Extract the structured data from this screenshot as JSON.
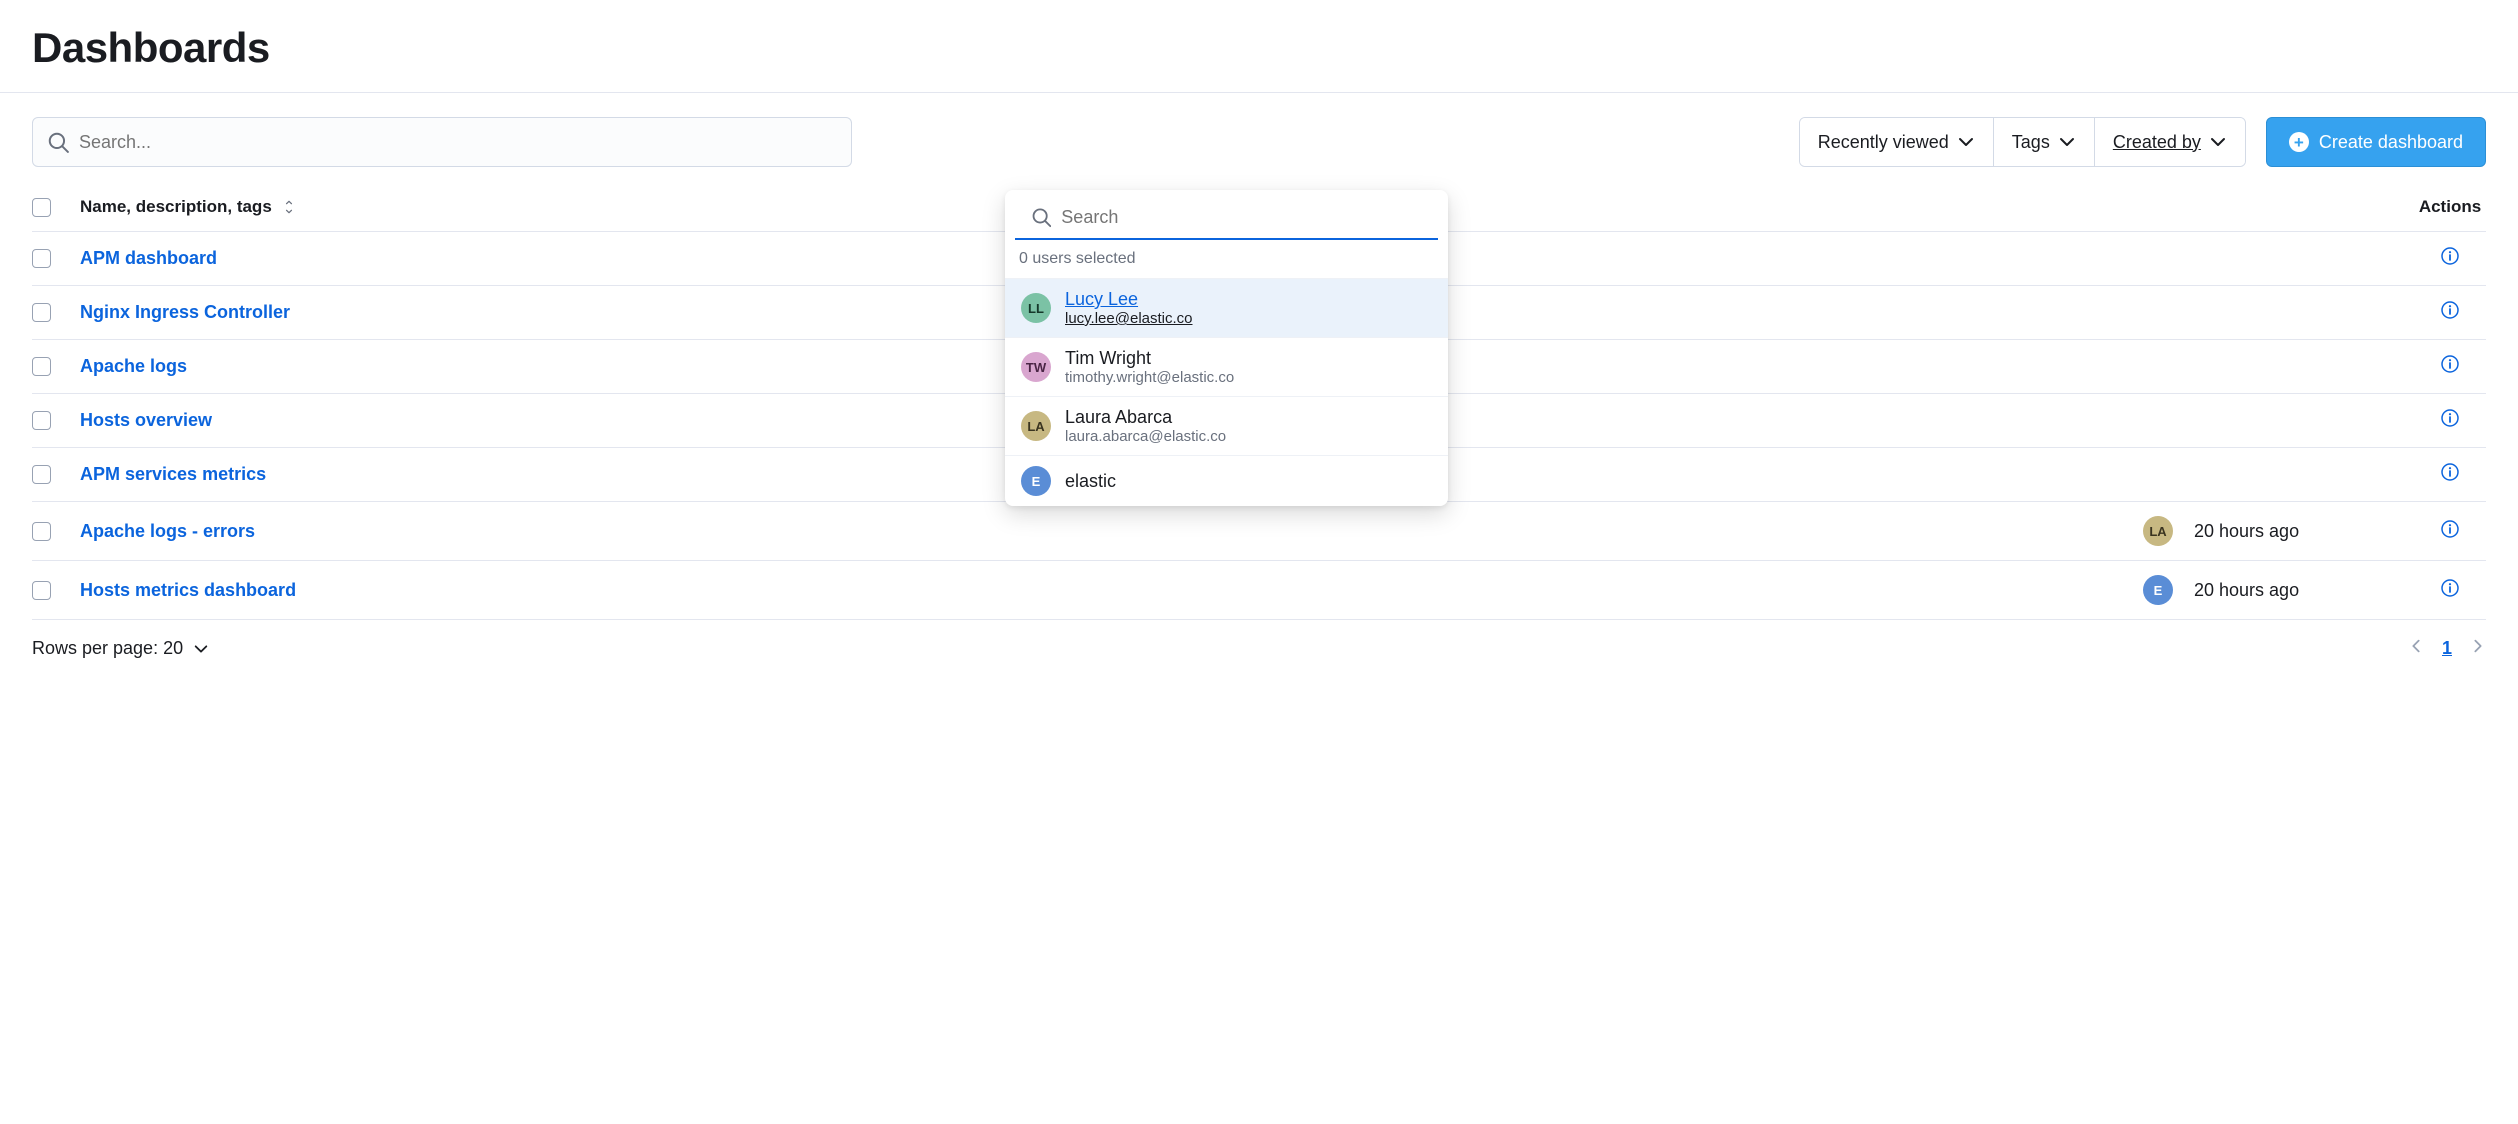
{
  "header": {
    "title": "Dashboards"
  },
  "search": {
    "placeholder": "Search..."
  },
  "filters": {
    "recent": "Recently viewed",
    "tags": "Tags",
    "created_by": "Created by"
  },
  "create_button": "Create dashboard",
  "columns": {
    "name": "Name, description, tags",
    "actions": "Actions"
  },
  "rows": [
    {
      "name": "APM dashboard",
      "creator": null,
      "updated": ""
    },
    {
      "name": "Nginx Ingress Controller",
      "creator": null,
      "updated": ""
    },
    {
      "name": "Apache logs",
      "creator": null,
      "updated": ""
    },
    {
      "name": "Hosts overview",
      "creator": null,
      "updated": ""
    },
    {
      "name": "APM services metrics",
      "creator": null,
      "updated": ""
    },
    {
      "name": "Apache logs - errors",
      "creator": {
        "initials": "LA",
        "cls": "av-la"
      },
      "updated": "20 hours ago"
    },
    {
      "name": "Hosts metrics dashboard",
      "creator": {
        "initials": "E",
        "cls": "av-e"
      },
      "updated": "20 hours ago"
    }
  ],
  "footer": {
    "rows_label": "Rows per page: 20",
    "page": "1"
  },
  "popover": {
    "search_placeholder": "Search",
    "status": "0 users selected",
    "users": [
      {
        "name": "Lucy Lee",
        "email": "lucy.lee@elastic.co",
        "initials": "LL",
        "cls": "av-ll",
        "hover": true
      },
      {
        "name": "Tim Wright",
        "email": "timothy.wright@elastic.co",
        "initials": "TW",
        "cls": "av-tw",
        "hover": false
      },
      {
        "name": "Laura Abarca",
        "email": "laura.abarca@elastic.co",
        "initials": "LA",
        "cls": "av-la",
        "hover": false
      },
      {
        "name": "elastic",
        "email": "",
        "initials": "E",
        "cls": "av-e",
        "hover": false
      }
    ]
  }
}
